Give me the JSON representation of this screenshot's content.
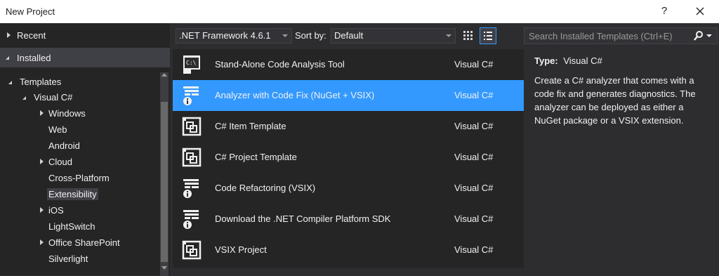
{
  "window": {
    "title": "New Project",
    "help_label": "?"
  },
  "left_panel": {
    "recent_label": "Recent",
    "installed_label": "Installed",
    "tree": [
      {
        "label": "Templates",
        "expanded": true
      },
      {
        "label": "Visual C#",
        "expanded": true
      },
      {
        "label": "Windows",
        "expandable": true
      },
      {
        "label": "Web"
      },
      {
        "label": "Android"
      },
      {
        "label": "Cloud",
        "expandable": true
      },
      {
        "label": "Cross-Platform"
      },
      {
        "label": "Extensibility",
        "selected": true
      },
      {
        "label": "iOS",
        "expandable": true
      },
      {
        "label": "LightSwitch"
      },
      {
        "label": "Office SharePoint",
        "expandable": true
      },
      {
        "label": "Silverlight"
      }
    ]
  },
  "toolbar": {
    "framework_value": ".NET Framework 4.6.1",
    "sort_label": "Sort by:",
    "sort_value": "Default",
    "search_placeholder": "Search Installed Templates (Ctrl+E)"
  },
  "templates": [
    {
      "name": "Stand-Alone Code Analysis Tool",
      "lang": "Visual C#",
      "icon": "console-app-icon"
    },
    {
      "name": "Analyzer with Code Fix (NuGet + VSIX)",
      "lang": "Visual C#",
      "icon": "analyzer-icon",
      "selected": true
    },
    {
      "name": "C# Item Template",
      "lang": "Visual C#",
      "icon": "template-icon"
    },
    {
      "name": "C# Project Template",
      "lang": "Visual C#",
      "icon": "template-icon"
    },
    {
      "name": "Code Refactoring (VSIX)",
      "lang": "Visual C#",
      "icon": "analyzer-icon"
    },
    {
      "name": "Download the .NET Compiler Platform SDK",
      "lang": "Visual C#",
      "icon": "analyzer-icon"
    },
    {
      "name": "VSIX Project",
      "lang": "Visual C#",
      "icon": "template-icon"
    }
  ],
  "details": {
    "type_label": "Type:",
    "type_value": "Visual C#",
    "description": "Create a C# analyzer that comes with a code fix and generates diagnostics. The analyzer can be deployed as either a NuGet package or a VSIX extension."
  },
  "colors": {
    "selection": "#3399ff",
    "background": "#2d2d30",
    "panel": "#252526"
  }
}
